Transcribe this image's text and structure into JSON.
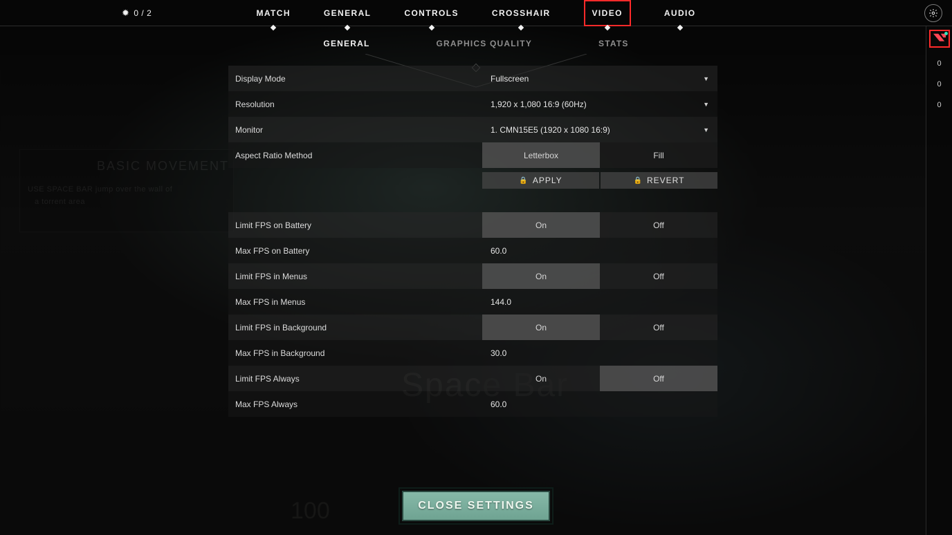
{
  "header": {
    "counter": "0 / 2",
    "tabs": [
      "MATCH",
      "GENERAL",
      "CONTROLS",
      "CROSSHAIR",
      "VIDEO",
      "AUDIO"
    ],
    "active_tab_index": 4
  },
  "subnav": {
    "tabs": [
      "GENERAL",
      "GRAPHICS QUALITY",
      "STATS"
    ],
    "active_index": 0
  },
  "rail": {
    "numbers": [
      "0",
      "0",
      "0"
    ]
  },
  "settings": {
    "display_mode": {
      "label": "Display Mode",
      "value": "Fullscreen"
    },
    "resolution": {
      "label": "Resolution",
      "value": "1,920 x 1,080 16:9 (60Hz)"
    },
    "monitor": {
      "label": "Monitor",
      "value": "1. CMN15E5 (1920 x  1080 16:9)"
    },
    "aspect_ratio": {
      "label": "Aspect Ratio Method",
      "opt_a": "Letterbox",
      "opt_b": "Fill",
      "selected": "a"
    },
    "apply_label": "APPLY",
    "revert_label": "REVERT",
    "limit_fps_battery": {
      "label": "Limit FPS on Battery",
      "on": "On",
      "off": "Off",
      "selected": "on"
    },
    "max_fps_battery": {
      "label": "Max FPS on Battery",
      "value": "60.0"
    },
    "limit_fps_menus": {
      "label": "Limit FPS in Menus",
      "on": "On",
      "off": "Off",
      "selected": "on"
    },
    "max_fps_menus": {
      "label": "Max FPS in Menus",
      "value": "144.0"
    },
    "limit_fps_background": {
      "label": "Limit FPS in Background",
      "on": "On",
      "off": "Off",
      "selected": "on"
    },
    "max_fps_background": {
      "label": "Max FPS in Background",
      "value": "30.0"
    },
    "limit_fps_always": {
      "label": "Limit FPS Always",
      "on": "On",
      "off": "Off",
      "selected": "off"
    },
    "max_fps_always": {
      "label": "Max FPS Always",
      "value": "60.0"
    }
  },
  "close_label": "CLOSE SETTINGS",
  "background_hints": {
    "panel_title": "BASIC MOVEMENT",
    "line1": "USE SPACE BAR  jump over  the wall of",
    "line2": "a torrent area",
    "key_hint": "Space Bar",
    "hud_number": "100"
  }
}
